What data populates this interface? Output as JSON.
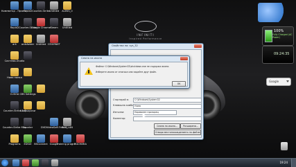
{
  "wallpaper": {
    "brand": "INFINITI",
    "tagline": "Inspired Performance"
  },
  "desktop_icons": [
    {
      "label": "Компютър - Пряк път",
      "kind": "app",
      "col": 0,
      "row": 0
    },
    {
      "label": "Rapid2",
      "kind": "app",
      "col": 1,
      "row": 0
    },
    {
      "label": "Counter-Strike",
      "kind": "dark",
      "col": 2,
      "row": 0
    },
    {
      "label": "Untitled",
      "kind": "gray",
      "col": 3,
      "row": 0
    },
    {
      "label": "ALEKS_0",
      "kind": "folder",
      "col": 4,
      "row": 0
    },
    {
      "label": "Rapid2",
      "kind": "app",
      "col": 0,
      "row": 1
    },
    {
      "label": "Counter-Strike",
      "kind": "dark",
      "col": 1,
      "row": 1
    },
    {
      "label": "Google Chrome",
      "kind": "red",
      "col": 2,
      "row": 1
    },
    {
      "label": "Steam",
      "kind": "dark",
      "col": 3,
      "row": 1
    },
    {
      "label": "Untitled",
      "kind": "gray",
      "col": 4,
      "row": 1
    },
    {
      "label": "ark",
      "kind": "folder",
      "col": 0,
      "row": 2
    },
    {
      "label": "ardsfolder",
      "kind": "folder",
      "col": 1,
      "row": 2
    },
    {
      "label": "Untitled",
      "kind": "gray",
      "col": 2,
      "row": 2
    },
    {
      "label": "CEVIRNET",
      "kind": "red",
      "col": 3,
      "row": 2
    },
    {
      "label": "Система-Studio",
      "kind": "folder",
      "col": 0,
      "row": 3
    },
    {
      "label": "",
      "kind": "dark",
      "col": 1,
      "row": 3
    },
    {
      "label": "Нова папка",
      "kind": "folder",
      "col": 0,
      "row": 4
    },
    {
      "label": "",
      "kind": "folder",
      "col": 1,
      "row": 4
    },
    {
      "label": "CUSOA",
      "kind": "app",
      "col": 0,
      "row": 5
    },
    {
      "label": "CBS Settings",
      "kind": "green",
      "col": 1,
      "row": 5
    },
    {
      "label": "",
      "kind": "folder",
      "col": 2,
      "row": 5
    },
    {
      "label": "Counter-Strike 1.6",
      "kind": "dark",
      "col": 0,
      "row": 6
    },
    {
      "label": "Шофьорски",
      "kind": "folder",
      "col": 1,
      "row": 6
    },
    {
      "label": "",
      "kind": "folder",
      "col": 2,
      "row": 6
    },
    {
      "label": "Counter-Strike Map",
      "kind": "dark",
      "col": 0,
      "row": 7
    },
    {
      "label": "Counter",
      "kind": "dark",
      "col": 1,
      "row": 7
    },
    {
      "label": "DVDVideoSoft Free Studio",
      "kind": "app",
      "col": 3,
      "row": 7
    },
    {
      "label": "BAL_LAN",
      "kind": "gray",
      "col": 4,
      "row": 7
    },
    {
      "label": "Programs",
      "kind": "folder",
      "col": 0,
      "row": 8
    },
    {
      "label": "EDSUI",
      "kind": "green",
      "col": 1,
      "row": 8
    },
    {
      "label": "BSConnect",
      "kind": "app",
      "col": 2,
      "row": 8
    },
    {
      "label": "Google",
      "kind": "red",
      "col": 3,
      "row": 8
    },
    {
      "label": "Training progra...",
      "kind": "app",
      "col": 4,
      "row": 8
    },
    {
      "label": "РОСНИКА",
      "kind": "red",
      "col": 5,
      "row": 8
    }
  ],
  "gadgets": {
    "battery_percent": "100%",
    "battery_status": "Fully Charged (AC Power)",
    "clock": "09:24:35",
    "search_label": "Google"
  },
  "shortcut_props": {
    "title": "Свойства на: sys_32",
    "start_in_label": "Стартирай в:",
    "start_in_value": "C:\\Windows\\System32",
    "hotkey_label": "Клавишна комбинация:",
    "hotkey_value": "Няма",
    "run_label": "Изпълни:",
    "run_value": "Нормален прозорец",
    "comment_label": "Коментар:",
    "change_icon_btn": "Смяна на икона...",
    "open_location_btn": "Отвори местонахождението на файла",
    "advanced_btn": "Разширени..."
  },
  "change_icon": {
    "title": "Смяна на икона",
    "msg1": "Файлът C:\\Windows\\System32\\shutdown.exe не съдържа икони.",
    "msg2": "Изберете икона от списъка или задайте друг файл.",
    "ok": "OK"
  },
  "taskbar": {
    "time": "19:24"
  },
  "icon_types": {
    "app": "app-icon",
    "folder": "folder-icon",
    "red": "app-icon",
    "green": "app-icon",
    "gray": "file-icon",
    "dark": "game-icon"
  }
}
